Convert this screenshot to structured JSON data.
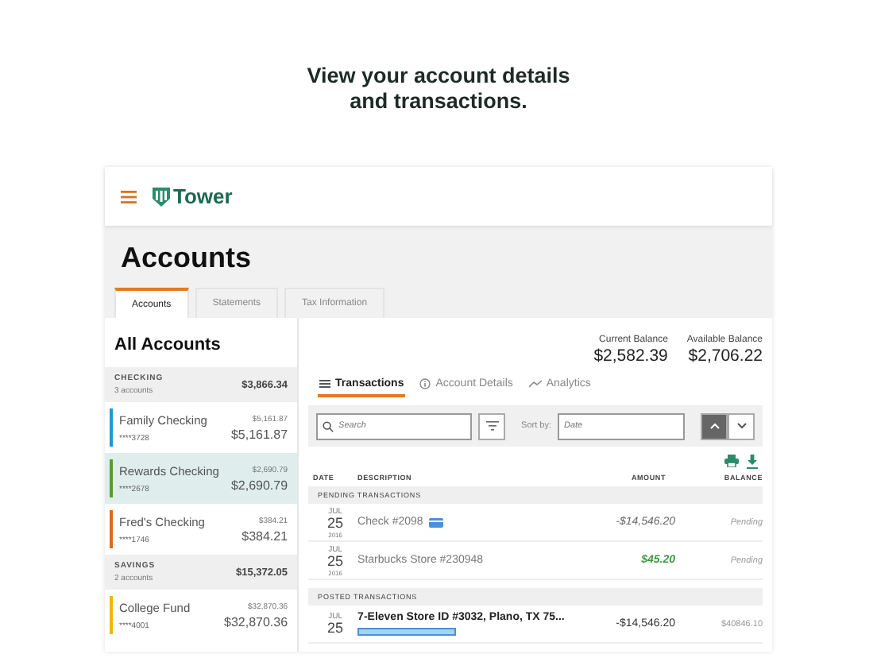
{
  "headline": "View your account details and transactions.",
  "brand": {
    "name": "Tower"
  },
  "page_title": "Accounts",
  "tabs": [
    {
      "label": "Accounts",
      "selected": true
    },
    {
      "label": "Statements",
      "selected": false
    },
    {
      "label": "Tax Information",
      "selected": false
    }
  ],
  "sidebar": {
    "title": "All Accounts",
    "groups": [
      {
        "name": "CHECKING",
        "count": "3 accounts",
        "total": "$3,866.34",
        "accounts": [
          {
            "name": "Family Checking",
            "number": "****3728",
            "small_amount": "$5,161.87",
            "amount": "$5,161.87",
            "color": "#1a9ad6",
            "selected": false
          },
          {
            "name": "Rewards Checking",
            "number": "****2678",
            "small_amount": "$2,690.79",
            "amount": "$2,690.79",
            "color": "#5a9a32",
            "selected": true
          },
          {
            "name": "Fred's Checking",
            "number": "****1746",
            "small_amount": "$384.21",
            "amount": "$384.21",
            "color": "#e06a1a",
            "selected": false
          }
        ]
      },
      {
        "name": "SAVINGS",
        "count": "2 accounts",
        "total": "$15,372.05",
        "accounts": [
          {
            "name": "College Fund",
            "number": "****4001",
            "small_amount": "$32,870.36",
            "amount": "$32,870.36",
            "color": "#f2b705",
            "selected": false
          }
        ]
      }
    ]
  },
  "balances": [
    {
      "label": "Current Balance",
      "value": "$2,582.39"
    },
    {
      "label": "Available Balance",
      "value": "$2,706.22"
    }
  ],
  "subtabs": [
    {
      "label": "Transactions",
      "selected": true
    },
    {
      "label": "Account Details",
      "selected": false
    },
    {
      "label": "Analytics",
      "selected": false
    }
  ],
  "search": {
    "placeholder": "Search"
  },
  "sort": {
    "label": "Sort by:",
    "placeholder": "Date",
    "directions": [
      {
        "kind": "up",
        "selected": true
      },
      {
        "kind": "down",
        "selected": false
      }
    ]
  },
  "table": {
    "columns": [
      "DATE",
      "DESCRIPTION",
      "AMOUNT",
      "BALANCE"
    ],
    "sections": [
      {
        "title": "PENDING TRANSACTIONS",
        "rows": [
          {
            "month": "JUL",
            "day": "25",
            "year": "2016",
            "description": "Check #2098",
            "card_icon": true,
            "amount": "-$14,546.20",
            "kind": "debit",
            "balance": "Pending"
          },
          {
            "month": "JUL",
            "day": "25",
            "year": "2016",
            "description": "Starbucks Store #230948",
            "card_icon": false,
            "amount": "$45.20",
            "kind": "credit",
            "balance": "Pending"
          }
        ]
      },
      {
        "title": "POSTED TRANSACTIONS",
        "rows": [
          {
            "month": "JUL",
            "day": "25",
            "description": "7-Eleven Store ID #3032, Plano, TX 75...",
            "card_icon": false,
            "tag": true,
            "amount": "-$14,546.20",
            "kind": "posted",
            "balance": "$40846.10"
          }
        ]
      }
    ]
  }
}
